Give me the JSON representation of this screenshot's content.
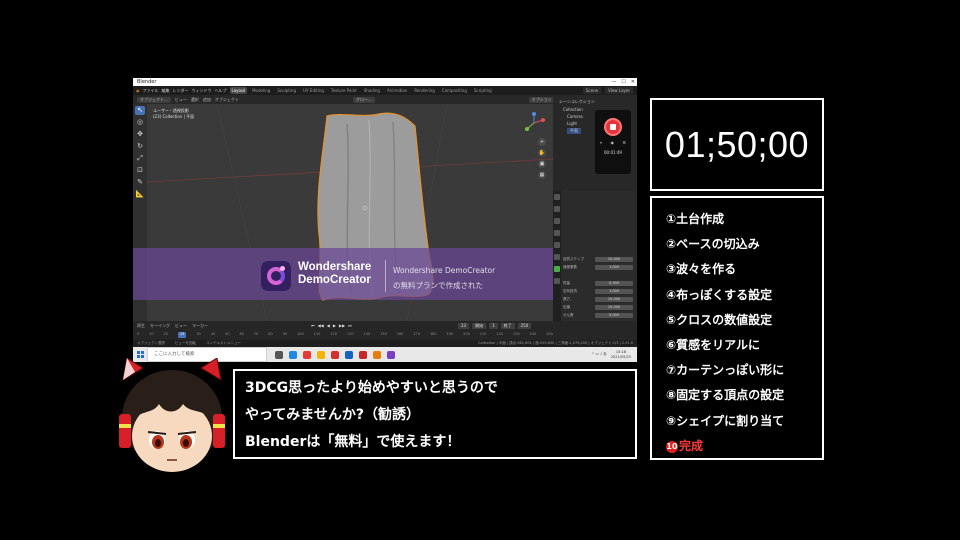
{
  "blender": {
    "title": "Blender",
    "menus": [
      "ファイル",
      "編集",
      "レンダー",
      "ウィンドウ",
      "ヘルプ"
    ],
    "workspaces": [
      "Layout",
      "Modeling",
      "Sculpting",
      "UV Editing",
      "Texture Paint",
      "Shading",
      "Animation",
      "Rendering",
      "Compositing",
      "Scripting"
    ],
    "active_workspace": "Layout",
    "scene": "Scene",
    "view_layer": "View Layer",
    "header": {
      "mode": "オブジェクト...",
      "view": "ビュー",
      "select": "選択",
      "add": "追加",
      "object": "オブジェクト",
      "orientation": "グロー...",
      "options": "オプション"
    },
    "viewport_info": {
      "line1": "ユーザー・透視投影",
      "line2": "(23) Collection | 平面"
    },
    "outliner": {
      "title": "シーンコレクション",
      "items": [
        "Collection",
        "Camera",
        "Light",
        "平面"
      ]
    },
    "props": {
      "rows": [
        {
          "label": "品質ステップ",
          "value": "10.000"
        },
        {
          "label": "速度乗数",
          "value": "1.000"
        },
        {
          "label": "質量",
          "value": "0.300"
        },
        {
          "label": "空気抵抗",
          "value": "1.000"
        },
        {
          "label": "張力",
          "value": "15.000"
        },
        {
          "label": "圧縮",
          "value": "15.000"
        },
        {
          "label": "せん断",
          "value": "5.000"
        },
        {
          "label": "曲げ",
          "value": "0.500"
        },
        {
          "label": "ピン留めグループ",
          "value": "グループ"
        },
        {
          "label": "剛性",
          "value": "1.000"
        }
      ],
      "sections": [
        "キャッシュ",
        "シェイプ",
        "コリジョン",
        "プロパティの重み",
        "フィールドの重み"
      ]
    },
    "recorder": {
      "time": "00:01:49"
    },
    "timeline": {
      "menus": [
        "再生",
        "キーイング",
        "ビュー",
        "マーカー"
      ],
      "current_frame": "23",
      "start_label": "開始",
      "start": "1",
      "end_label": "終了",
      "end": "250",
      "ruler": [
        "0",
        "10",
        "20",
        "23",
        "30",
        "40",
        "50",
        "60",
        "70",
        "80",
        "90",
        "100",
        "110",
        "120",
        "130",
        "140",
        "150",
        "160",
        "170",
        "180",
        "190",
        "200",
        "210",
        "220",
        "230",
        "240",
        "250"
      ]
    },
    "status": {
      "left1": "オブジェクト選択",
      "left2": "ビューを回転",
      "left3": "コンテキストメニュー",
      "right": "Collection | 平面 | 頂点:561,601 | 面:539,600 | 三角面:1,079,200 | オブジェクト:1/3 | 2.91.0"
    },
    "taskbar": {
      "search_placeholder": "ここに入力して検索",
      "clock_time": "15:18",
      "clock_date": "2021/05/25"
    }
  },
  "watermark": {
    "brand_line1": "Wondershare",
    "brand_line2": "DemoCreator",
    "product": "Wondershare DemoCreator",
    "notice": "の無料プランで作成された"
  },
  "timer": "01;50;00",
  "steps": [
    {
      "num": "①",
      "text": "土台作成"
    },
    {
      "num": "②",
      "text": "ベースの切込み"
    },
    {
      "num": "③",
      "text": "波々を作る"
    },
    {
      "num": "④",
      "text": "布っぽくする設定"
    },
    {
      "num": "⑤",
      "text": "クロスの数値設定"
    },
    {
      "num": "⑥",
      "text": "質感をリアルに"
    },
    {
      "num": "⑦",
      "text": "カーテンっぽい形に"
    },
    {
      "num": "⑧",
      "text": "固定する頂点の設定"
    },
    {
      "num": "⑨",
      "text": "シェイプに割り当て"
    },
    {
      "num": "10",
      "text": "完成"
    }
  ],
  "subtitle": {
    "line1": "3DCG思ったより始めやすいと思うので",
    "line2": "やってみませんか?（勧誘）",
    "line3": "Blenderは「無料」で使えます！"
  },
  "colors": {
    "accent_red": "#e02020",
    "blender_blue": "#4772b3",
    "watermark_purple": "#6a4696"
  }
}
